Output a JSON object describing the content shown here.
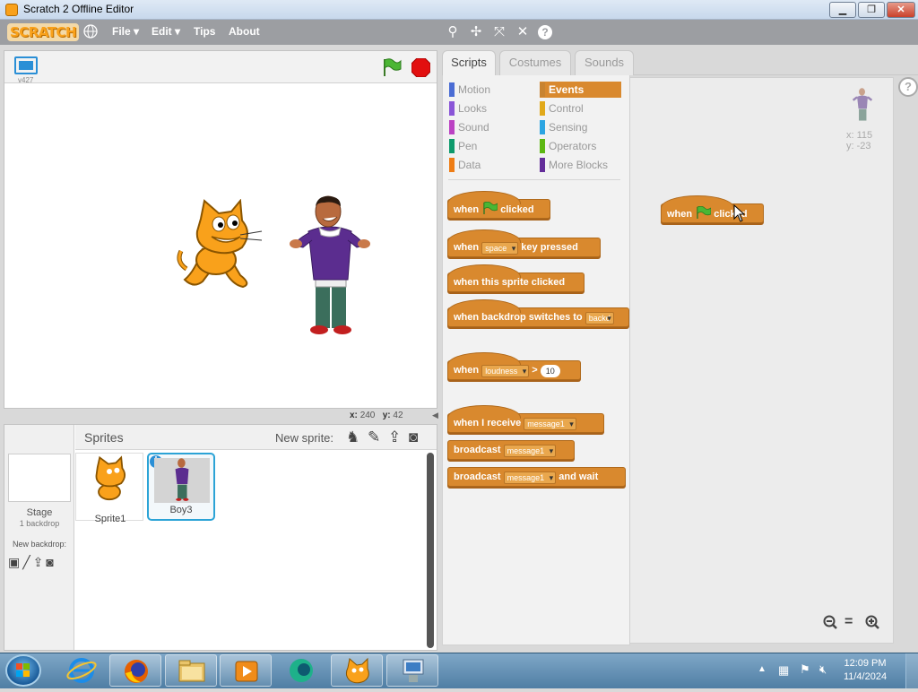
{
  "window": {
    "title": "Scratch 2 Offline Editor",
    "min": "▁",
    "max": "❐",
    "close": "✕"
  },
  "menu": {
    "logo": "SCRATCH",
    "file": "File ▾",
    "edit": "Edit ▾",
    "tips": "Tips",
    "about": "About"
  },
  "stage": {
    "version": "v427",
    "x_label": "x:",
    "x_value": "240",
    "y_label": "y:",
    "y_value": "42"
  },
  "tabs": [
    {
      "label": "Scripts"
    },
    {
      "label": "Costumes"
    },
    {
      "label": "Sounds"
    }
  ],
  "palette": {
    "categories_left": [
      "Motion",
      "Looks",
      "Sound",
      "Pen",
      "Data"
    ],
    "categories_right": [
      "Events",
      "Control",
      "Sensing",
      "Operators",
      "More Blocks"
    ],
    "colors_left": [
      "#4a6cd4",
      "#8a55d7",
      "#bb42c3",
      "#0e9a6c",
      "#ee7d16"
    ],
    "colors_right": [
      "#c88330",
      "#e1a91a",
      "#2ca5e2",
      "#5cb712",
      "#632d99"
    ]
  },
  "blocks": {
    "green_flag": {
      "pre": "when",
      "post": "clicked"
    },
    "key_pressed": {
      "pre": "when",
      "dd": "space",
      "post": "key pressed"
    },
    "sprite_clicked": {
      "text": "when this sprite clicked"
    },
    "backdrop": {
      "pre": "when backdrop switches to",
      "dd": "backd"
    },
    "loudness": {
      "pre": "when",
      "dd": "loudness",
      "op": ">",
      "num": "10"
    },
    "receive": {
      "pre": "when I receive",
      "dd": "message1"
    },
    "broadcast": {
      "pre": "broadcast",
      "dd": "message1"
    },
    "broadcast_wait": {
      "pre": "broadcast",
      "dd": "message1",
      "post": "and wait"
    }
  },
  "scripts_area": {
    "script_pre": "when",
    "script_post": "clicked",
    "sprite_x": "x: 115",
    "sprite_y": "y: -23",
    "help": "?"
  },
  "sprites_pane": {
    "header": "Sprites",
    "new_sprite": "New sprite:",
    "stage_label": "Stage",
    "stage_sub": "1 backdrop",
    "new_backdrop": "New backdrop:",
    "sprites": [
      {
        "name": "Sprite1"
      },
      {
        "name": "Boy3"
      }
    ]
  },
  "taskbar": {
    "time": "12:09 PM",
    "date": "11/4/2024"
  }
}
